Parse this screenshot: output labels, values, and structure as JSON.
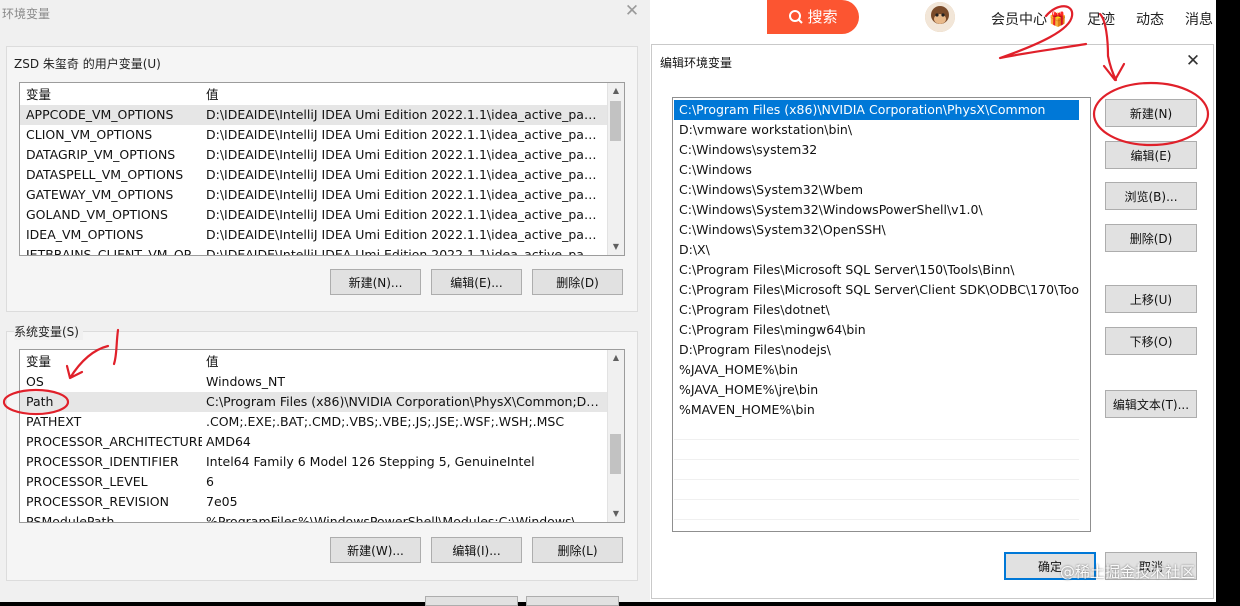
{
  "env_window": {
    "title": "环境变量",
    "close_glyph": "✕",
    "user_vars": {
      "label": "ZSD 朱玺奇 的用户变量(U)",
      "col_var": "变量",
      "col_val": "值",
      "rows": [
        {
          "name": "APPCODE_VM_OPTIONS",
          "value": "D:\\IDEAIDE\\IntelliJ IDEA Umi Edition 2022.1.1\\idea_active_packa..."
        },
        {
          "name": "CLION_VM_OPTIONS",
          "value": "D:\\IDEAIDE\\IntelliJ IDEA Umi Edition 2022.1.1\\idea_active_packa..."
        },
        {
          "name": "DATAGRIP_VM_OPTIONS",
          "value": "D:\\IDEAIDE\\IntelliJ IDEA Umi Edition 2022.1.1\\idea_active_packa..."
        },
        {
          "name": "DATASPELL_VM_OPTIONS",
          "value": "D:\\IDEAIDE\\IntelliJ IDEA Umi Edition 2022.1.1\\idea_active_packa..."
        },
        {
          "name": "GATEWAY_VM_OPTIONS",
          "value": "D:\\IDEAIDE\\IntelliJ IDEA Umi Edition 2022.1.1\\idea_active_packa..."
        },
        {
          "name": "GOLAND_VM_OPTIONS",
          "value": "D:\\IDEAIDE\\IntelliJ IDEA Umi Edition 2022.1.1\\idea_active_packa..."
        },
        {
          "name": "IDEA_VM_OPTIONS",
          "value": "D:\\IDEAIDE\\IntelliJ IDEA Umi Edition 2022.1.1\\idea_active_packa..."
        },
        {
          "name": "JETBRAINS_CLIENT_VM_OP...",
          "value": "D:\\IDEAIDE\\IntelliJ IDEA Umi Edition 2022.1.1\\idea_active_packa..."
        }
      ],
      "buttons": {
        "new": "新建(N)...",
        "edit": "编辑(E)...",
        "delete": "删除(D)"
      }
    },
    "system_vars": {
      "label": "系统变量(S)",
      "col_var": "变量",
      "col_val": "值",
      "rows": [
        {
          "name": "OS",
          "value": "Windows_NT"
        },
        {
          "name": "Path",
          "value": "C:\\Program Files (x86)\\NVIDIA Corporation\\PhysX\\Common;D:\\..."
        },
        {
          "name": "PATHEXT",
          "value": ".COM;.EXE;.BAT;.CMD;.VBS;.VBE;.JS;.JSE;.WSF;.WSH;.MSC"
        },
        {
          "name": "PROCESSOR_ARCHITECTURE",
          "value": "AMD64"
        },
        {
          "name": "PROCESSOR_IDENTIFIER",
          "value": "Intel64 Family 6 Model 126 Stepping 5, GenuineIntel"
        },
        {
          "name": "PROCESSOR_LEVEL",
          "value": "6"
        },
        {
          "name": "PROCESSOR_REVISION",
          "value": "7e05"
        },
        {
          "name": "PSModulePath",
          "value": "%ProgramFiles%\\WindowsPowerShell\\Modules;C:\\Windows\\..."
        }
      ],
      "buttons": {
        "new": "新建(W)...",
        "edit": "编辑(I)...",
        "delete": "删除(L)"
      }
    },
    "scroll_up": "▲",
    "scroll_down": "▼"
  },
  "browser": {
    "search_label": "搜索",
    "nav": {
      "member": "会员中心",
      "footprint": "足迹",
      "dynamic": "动态",
      "messages": "消息"
    }
  },
  "edit_dialog": {
    "title": "编辑环境变量",
    "close_glyph": "✕",
    "paths": [
      "C:\\Program Files (x86)\\NVIDIA Corporation\\PhysX\\Common",
      "D:\\vmware workstation\\bin\\",
      "C:\\Windows\\system32",
      "C:\\Windows",
      "C:\\Windows\\System32\\Wbem",
      "C:\\Windows\\System32\\WindowsPowerShell\\v1.0\\",
      "C:\\Windows\\System32\\OpenSSH\\",
      "D:\\X\\",
      "C:\\Program Files\\Microsoft SQL Server\\150\\Tools\\Binn\\",
      "C:\\Program Files\\Microsoft SQL Server\\Client SDK\\ODBC\\170\\Too...",
      "C:\\Program Files\\dotnet\\",
      "C:\\Program Files\\mingw64\\bin",
      "D:\\Program Files\\nodejs\\",
      "%JAVA_HOME%\\bin",
      "%JAVA_HOME%\\jre\\bin",
      "%MAVEN_HOME%\\bin"
    ],
    "buttons": {
      "new": "新建(N)",
      "edit": "编辑(E)",
      "browse": "浏览(B)...",
      "delete": "删除(D)",
      "move_up": "上移(U)",
      "move_down": "下移(O)",
      "edit_text": "编辑文本(T)...",
      "ok": "确定",
      "cancel": "取消"
    }
  },
  "annotations": {
    "handwritten_number": "2"
  },
  "watermark": "@稀土掘金技术社区",
  "colors": {
    "accent": "#fc5531",
    "selection": "#0078d7",
    "annotation": "#e0202a"
  }
}
